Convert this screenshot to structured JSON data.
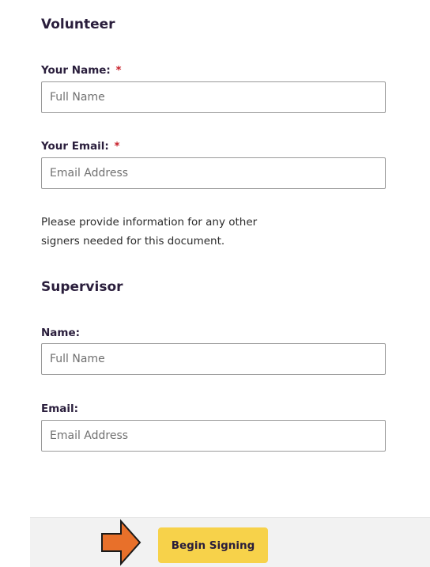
{
  "volunteer": {
    "title": "Volunteer",
    "name_label": "Your Name:",
    "name_placeholder": "Full Name",
    "email_label": "Your Email:",
    "email_placeholder": "Email Address",
    "required_marker": "*"
  },
  "info": {
    "line1": "Please provide information for any other",
    "line2": "signers needed for this document."
  },
  "supervisor": {
    "title": "Supervisor",
    "name_label": "Name:",
    "name_placeholder": "Full Name",
    "email_label": "Email:",
    "email_placeholder": "Email Address"
  },
  "footer": {
    "begin_label": "Begin Signing",
    "arrow_icon": "arrow-right-icon",
    "arrow_color": "#e8702a",
    "button_color": "#f7d24a"
  }
}
